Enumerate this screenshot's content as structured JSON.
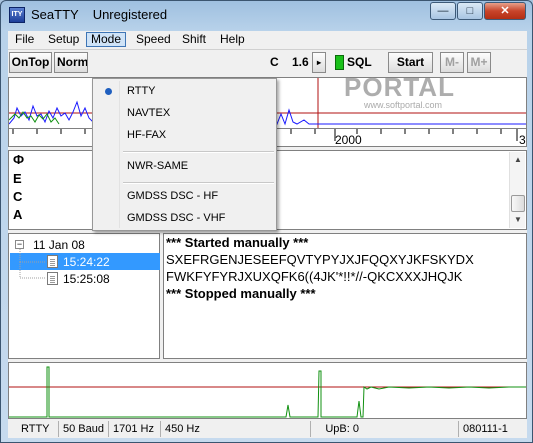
{
  "window": {
    "title": "SeaTTY",
    "status": "Unregistered",
    "icon_label": "ITY",
    "minimize": "—",
    "maximize": "□",
    "close": "✕"
  },
  "menubar": [
    "File",
    "Setup",
    "Mode",
    "Speed",
    "Shift",
    "Help"
  ],
  "toolbar": {
    "ontop": "OnTop",
    "norm": "Norm",
    "c_label": "C",
    "value": "1.6",
    "sql": "SQL",
    "start": "Start",
    "m_minus": "M-",
    "m_plus": "M+"
  },
  "mode_menu": {
    "items": [
      {
        "label": "RTTY",
        "checked": true
      },
      {
        "label": "NAVTEX",
        "checked": false
      },
      {
        "label": "HF-FAX",
        "checked": false
      },
      {
        "label": "NWR-SAME",
        "checked": false
      },
      {
        "label": "GMDSS DSC - HF",
        "checked": false
      },
      {
        "label": "GMDSS DSC - VHF",
        "checked": false
      }
    ]
  },
  "spectrum": {
    "watermark": "PORTAL",
    "watermark_url": "www.softportal.com",
    "ruler_labels": [
      "2000",
      "3"
    ]
  },
  "characters": [
    "Ф",
    "Е",
    "С",
    "А"
  ],
  "tree": {
    "root": "11 Jan 08",
    "expand": "−",
    "entries": [
      "15:24:22",
      "15:25:08"
    ]
  },
  "message": {
    "lines": [
      "*** Started manually ***",
      "SXEFRGENJESEEFQVTYPYJXJFQQXYJKFSKYDX",
      "FWKFYFYRJXUXQFK6((4JK'*!!*//-QKCXXXJHQJK",
      "*** Stopped manually ***"
    ]
  },
  "statusbar": {
    "mode": "RTTY",
    "baud": "50 Baud",
    "freq": "1701 Hz",
    "shift": "450 Hz",
    "upb": "UpB: 0",
    "version": "080111-1"
  },
  "colors": {
    "spectrum_trace": "#1a1aff",
    "marker_line": "#b01010",
    "scope_trace": "#109010",
    "scope_level": "#b01010",
    "selection": "#3399ff"
  }
}
